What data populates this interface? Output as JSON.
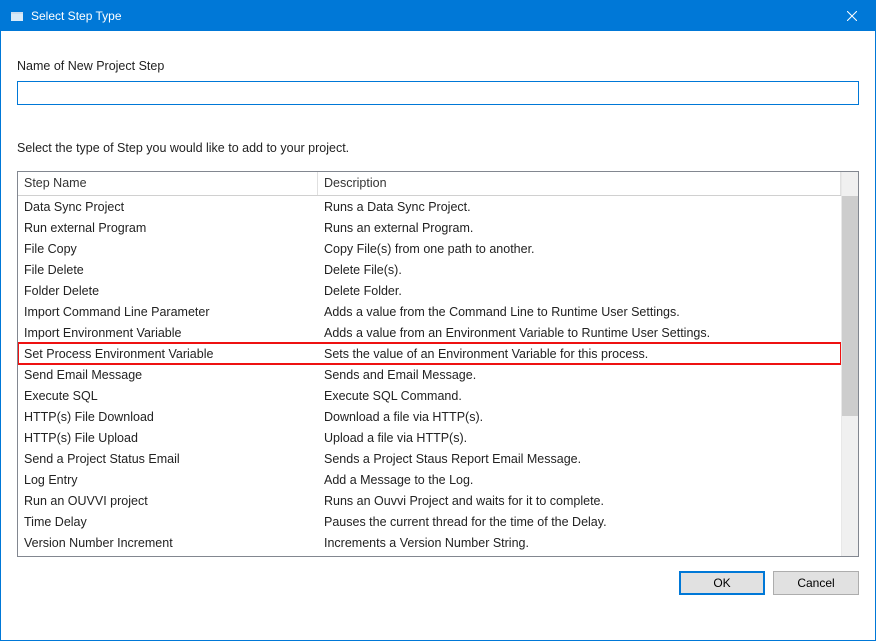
{
  "titlebar": {
    "title": "Select Step Type"
  },
  "labels": {
    "name_label": "Name of New Project Step",
    "instruction": "Select the type of Step you would like to add to your project."
  },
  "input": {
    "value": "",
    "placeholder": ""
  },
  "columns": {
    "name": "Step Name",
    "desc": "Description"
  },
  "rows": [
    {
      "name": "Data Sync Project",
      "desc": "Runs a Data Sync Project.",
      "hl": false
    },
    {
      "name": "Run external Program",
      "desc": "Runs an external Program.",
      "hl": false
    },
    {
      "name": "File Copy",
      "desc": "Copy File(s) from one path to another.",
      "hl": false
    },
    {
      "name": "File Delete",
      "desc": "Delete File(s).",
      "hl": false
    },
    {
      "name": "Folder Delete",
      "desc": "Delete Folder.",
      "hl": false
    },
    {
      "name": "Import Command Line Parameter",
      "desc": "Adds a value from the Command Line to Runtime User Settings.",
      "hl": false
    },
    {
      "name": "Import Environment Variable",
      "desc": "Adds a value from an Environment Variable to Runtime User Settings.",
      "hl": false
    },
    {
      "name": "Set Process Environment Variable",
      "desc": "Sets the value of an Environment Variable for this process.",
      "hl": true
    },
    {
      "name": "Send Email Message",
      "desc": "Sends and Email Message.",
      "hl": false
    },
    {
      "name": "Execute SQL",
      "desc": "Execute SQL Command.",
      "hl": false
    },
    {
      "name": "HTTP(s) File Download",
      "desc": "Download a file via HTTP(s).",
      "hl": false
    },
    {
      "name": "HTTP(s) File Upload",
      "desc": "Upload a file via HTTP(s).",
      "hl": false
    },
    {
      "name": "Send a Project Status Email",
      "desc": "Sends a Project Staus Report Email Message.",
      "hl": false
    },
    {
      "name": "Log Entry",
      "desc": "Add a Message to the Log.",
      "hl": false
    },
    {
      "name": "Run an OUVVI project",
      "desc": "Runs an Ouvvi Project and waits for it to complete.",
      "hl": false
    },
    {
      "name": "Time Delay",
      "desc": "Pauses the current thread for the time of the Delay.",
      "hl": false
    },
    {
      "name": "Version Number Increment",
      "desc": "Increments a Version Number String.",
      "hl": false
    }
  ],
  "buttons": {
    "ok": "OK",
    "cancel": "Cancel"
  }
}
